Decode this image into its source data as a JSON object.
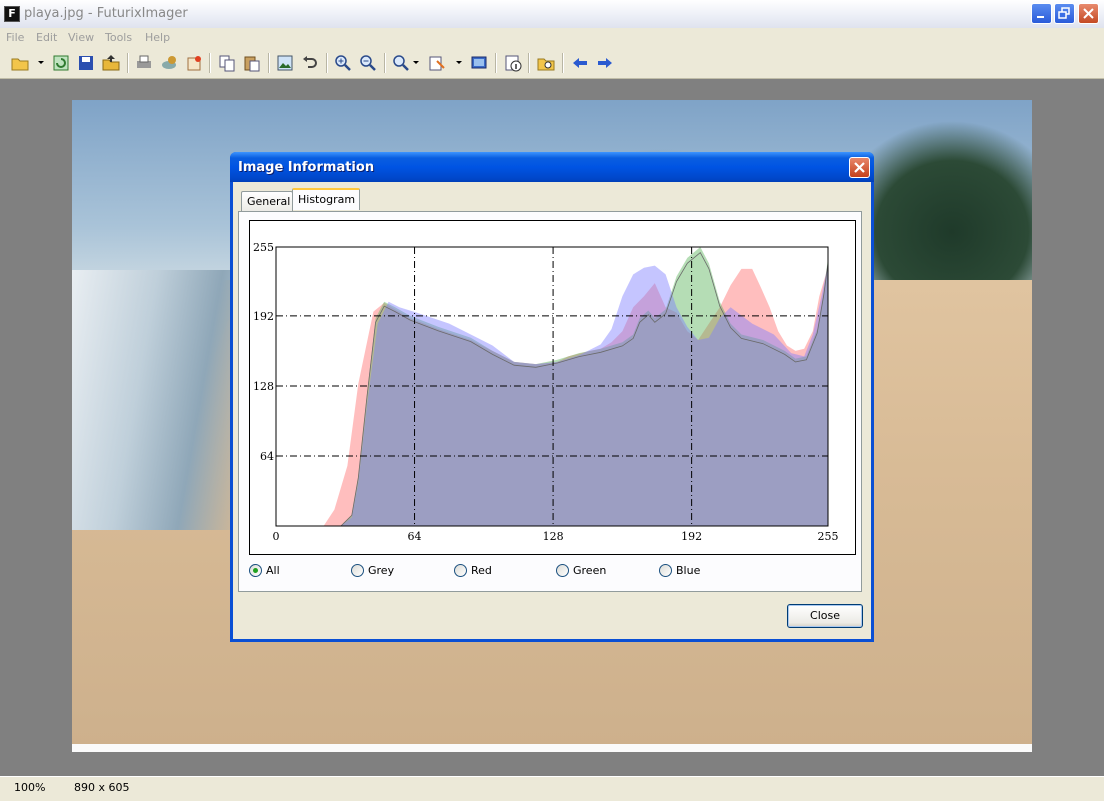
{
  "window": {
    "title": "playa.jpg - FuturixImager",
    "icon_letter": "F",
    "buttons": [
      "minimize-icon",
      "restore-icon",
      "close-icon"
    ]
  },
  "menu": [
    "File",
    "Edit",
    "View",
    "Tools",
    "Help"
  ],
  "toolbar": {
    "icons": [
      "open-icon",
      "reload-icon",
      "save-icon",
      "open-folder-icon",
      "print-icon",
      "scan-icon",
      "plugin-icon",
      "copy-icon",
      "paste-icon",
      "image-properties-icon",
      "undo-icon",
      "zoom-in-icon",
      "zoom-out-icon",
      "zoom-menu-icon",
      "effects-icon",
      "fullscreen-icon",
      "info-icon",
      "browse-icon",
      "prev-arrow-icon",
      "next-arrow-icon"
    ]
  },
  "status": {
    "zoom": "100%",
    "dimensions": "890 x 605"
  },
  "dialog": {
    "title": "Image Information",
    "tabs": [
      {
        "label": "General",
        "active": false
      },
      {
        "label": "Histogram",
        "active": true
      }
    ],
    "radios": [
      {
        "label": "All",
        "checked": true
      },
      {
        "label": "Grey",
        "checked": false
      },
      {
        "label": "Red",
        "checked": false
      },
      {
        "label": "Green",
        "checked": false
      },
      {
        "label": "Blue",
        "checked": false
      }
    ],
    "close_label": "Close"
  },
  "chart_data": {
    "type": "area",
    "x_ticks": [
      "0",
      "64",
      "128",
      "192",
      "255"
    ],
    "y_ticks": [
      "255",
      "192",
      "128",
      "64"
    ],
    "xlim": [
      0,
      255
    ],
    "ylim": [
      0,
      255
    ],
    "grid": true,
    "series": [
      {
        "color": "#ff6e6e",
        "points": [
          [
            22,
            0
          ],
          [
            27,
            15
          ],
          [
            33,
            55
          ],
          [
            38,
            130
          ],
          [
            45,
            196
          ],
          [
            50,
            204
          ],
          [
            55,
            198
          ],
          [
            62,
            190
          ],
          [
            75,
            180
          ],
          [
            90,
            170
          ],
          [
            100,
            160
          ],
          [
            110,
            150
          ],
          [
            120,
            148
          ],
          [
            130,
            150
          ],
          [
            135,
            155
          ],
          [
            145,
            160
          ],
          [
            150,
            162
          ],
          [
            155,
            168
          ],
          [
            160,
            178
          ],
          [
            165,
            200
          ],
          [
            170,
            210
          ],
          [
            175,
            222
          ],
          [
            180,
            200
          ],
          [
            185,
            195
          ],
          [
            190,
            178
          ],
          [
            195,
            170
          ],
          [
            200,
            185
          ],
          [
            205,
            200
          ],
          [
            210,
            220
          ],
          [
            215,
            235
          ],
          [
            220,
            235
          ],
          [
            224,
            218
          ],
          [
            228,
            200
          ],
          [
            232,
            178
          ],
          [
            236,
            165
          ],
          [
            240,
            160
          ],
          [
            244,
            162
          ],
          [
            248,
            178
          ],
          [
            251,
            210
          ],
          [
            254,
            230
          ],
          [
            255,
            240
          ]
        ]
      },
      {
        "color": "#5ab45a",
        "points": [
          [
            30,
            0
          ],
          [
            35,
            10
          ],
          [
            38,
            45
          ],
          [
            42,
            120
          ],
          [
            46,
            190
          ],
          [
            50,
            205
          ],
          [
            55,
            200
          ],
          [
            62,
            192
          ],
          [
            75,
            182
          ],
          [
            90,
            172
          ],
          [
            100,
            160
          ],
          [
            110,
            150
          ],
          [
            120,
            148
          ],
          [
            130,
            152
          ],
          [
            140,
            158
          ],
          [
            150,
            162
          ],
          [
            160,
            168
          ],
          [
            165,
            175
          ],
          [
            168,
            190
          ],
          [
            172,
            197
          ],
          [
            175,
            190
          ],
          [
            180,
            198
          ],
          [
            185,
            228
          ],
          [
            190,
            245
          ],
          [
            196,
            255
          ],
          [
            200,
            240
          ],
          [
            205,
            205
          ],
          [
            210,
            185
          ],
          [
            215,
            175
          ],
          [
            225,
            170
          ],
          [
            235,
            160
          ],
          [
            240,
            153
          ],
          [
            245,
            155
          ],
          [
            250,
            180
          ],
          [
            253,
            215
          ],
          [
            255,
            245
          ]
        ]
      },
      {
        "color": "#7e7eff",
        "points": [
          [
            30,
            0
          ],
          [
            35,
            8
          ],
          [
            38,
            40
          ],
          [
            42,
            110
          ],
          [
            47,
            185
          ],
          [
            52,
            205
          ],
          [
            57,
            200
          ],
          [
            65,
            195
          ],
          [
            80,
            185
          ],
          [
            90,
            175
          ],
          [
            100,
            165
          ],
          [
            110,
            150
          ],
          [
            120,
            148
          ],
          [
            130,
            150
          ],
          [
            140,
            156
          ],
          [
            150,
            166
          ],
          [
            155,
            180
          ],
          [
            160,
            210
          ],
          [
            165,
            230
          ],
          [
            170,
            236
          ],
          [
            175,
            238
          ],
          [
            180,
            230
          ],
          [
            185,
            200
          ],
          [
            190,
            182
          ],
          [
            195,
            170
          ],
          [
            200,
            172
          ],
          [
            205,
            190
          ],
          [
            210,
            200
          ],
          [
            220,
            185
          ],
          [
            230,
            175
          ],
          [
            238,
            158
          ],
          [
            244,
            155
          ],
          [
            248,
            175
          ],
          [
            252,
            210
          ],
          [
            255,
            240
          ]
        ]
      }
    ]
  }
}
